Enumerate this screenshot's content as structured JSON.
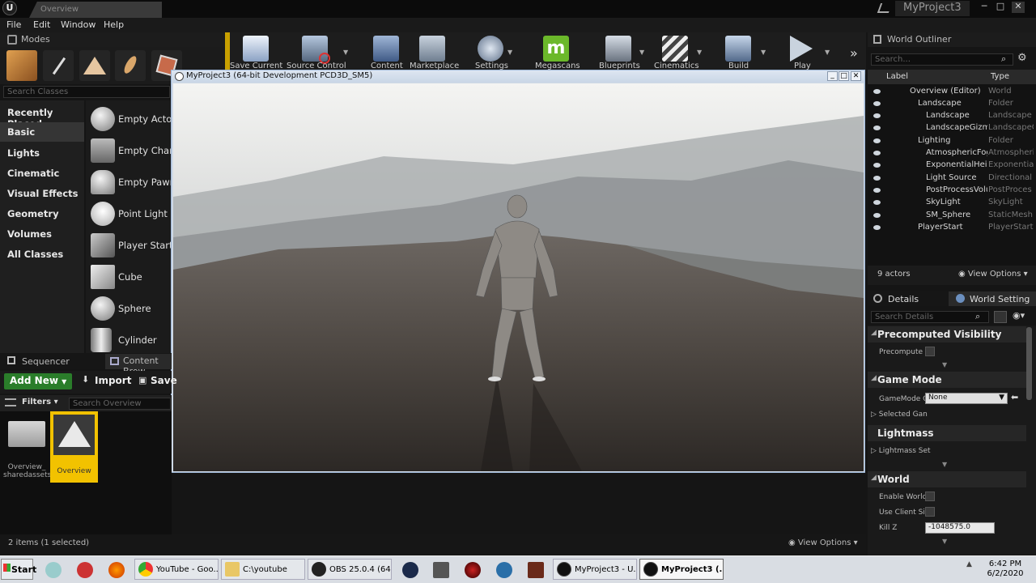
{
  "title_bar": {
    "doc_tab": "Overview",
    "project_name": "MyProject3"
  },
  "menu": [
    "File",
    "Edit",
    "Window",
    "Help"
  ],
  "modes": {
    "tab_label": "Modes",
    "search_placeholder": "Search Classes",
    "categories": [
      "Recently Placed",
      "Basic",
      "Lights",
      "Cinematic",
      "Visual Effects",
      "Geometry",
      "Volumes",
      "All Classes"
    ],
    "selected_category": "Basic",
    "classes": [
      "Empty Actor",
      "Empty Chara",
      "Empty Pawn",
      "Point Light",
      "Player Start",
      "Cube",
      "Sphere",
      "Cylinder"
    ]
  },
  "toolbar": [
    "Save Current",
    "Source Control",
    "Content",
    "Marketplace",
    "Settings",
    "Megascans",
    "Blueprints",
    "Cinematics",
    "Build",
    "Play"
  ],
  "viewport": {
    "window_title": "MyProject3 (64-bit Development PCD3D_SM5)"
  },
  "content_browser": {
    "tabs": [
      "Sequencer",
      "Content Brow"
    ],
    "add_new": "Add New",
    "import": "Import",
    "save": "Save",
    "filters": "Filters",
    "search_placeholder": "Search Overview",
    "items": [
      {
        "label": "Overview_ sharedassets"
      },
      {
        "label": "Overview"
      }
    ],
    "status": "2 items (1 selected)",
    "view_options": "View Options"
  },
  "world_outliner": {
    "tab_label": "World Outliner",
    "search_placeholder": "Search...",
    "columns": {
      "label": "Label",
      "type": "Type"
    },
    "rows": [
      {
        "label": "Overview (Editor)",
        "type": "World"
      },
      {
        "label": "Landscape",
        "type": "Folder"
      },
      {
        "label": "Landscape",
        "type": "Landscape"
      },
      {
        "label": "LandscapeGizmo",
        "type": "LandscapeG"
      },
      {
        "label": "Lighting",
        "type": "Folder"
      },
      {
        "label": "AtmosphericFog",
        "type": "Atmospheri"
      },
      {
        "label": "ExponentialHeigh",
        "type": "Exponentia"
      },
      {
        "label": "Light Source",
        "type": "Directional"
      },
      {
        "label": "PostProcessVolu",
        "type": "PostProces"
      },
      {
        "label": "SkyLight",
        "type": "SkyLight"
      },
      {
        "label": "SM_Sphere",
        "type": "StaticMesh"
      },
      {
        "label": "PlayerStart",
        "type": "PlayerStart"
      }
    ],
    "actor_count": "9 actors",
    "view_options": "View Options"
  },
  "details": {
    "tabs": [
      "Details",
      "World Setting"
    ],
    "search_placeholder": "Search Details",
    "sections": [
      {
        "title": "Precomputed Visibility",
        "props": [
          "Precompute V"
        ]
      },
      {
        "title": "Game Mode",
        "props": [
          "GameMode O",
          "Selected Gan"
        ]
      },
      {
        "title": "Lightmass",
        "props": [
          "Lightmass Set"
        ]
      },
      {
        "title": "World",
        "props": [
          "Enable World",
          "Use Client Sid",
          "Kill Z"
        ]
      }
    ],
    "gamemode_value": "None",
    "killz_value": "-1048575.0"
  },
  "taskbar": {
    "start": "Start",
    "apps": [
      "YouTube - Goo...",
      "C:\\youtube",
      "OBS 25.0.4 (64...",
      "MyProject3 - U...",
      "MyProject3 (..."
    ],
    "time": "6:42 PM",
    "date": "6/2/2020"
  },
  "colors": {
    "accent_green": "#2a7d2a",
    "selection_yellow": "#f2c200",
    "panel_bg": "#1b1b1b"
  }
}
